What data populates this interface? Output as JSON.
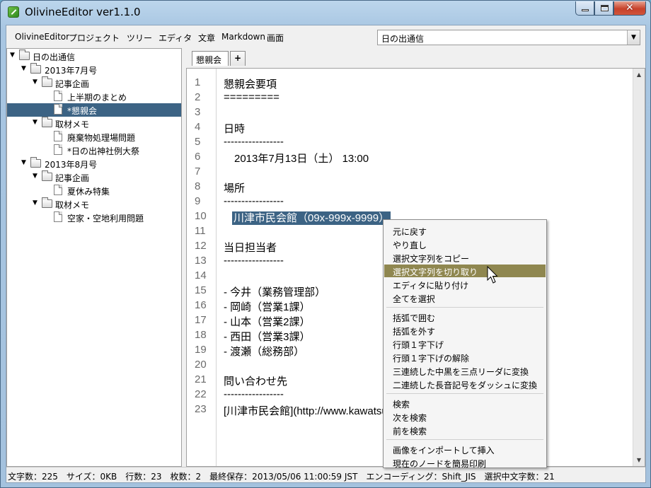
{
  "window": {
    "title": "OlivineEditor ver1.1.0",
    "close_glyph": "✕"
  },
  "menubar": {
    "items": [
      "OlivineEditor",
      "プロジェクト",
      "ツリー",
      "エディタ",
      "文章",
      "Markdown",
      "画面"
    ],
    "document_select": {
      "selected": "日の出通信",
      "arrow": "▼"
    }
  },
  "tree": {
    "items": [
      {
        "label": "日の出通信",
        "type": "folder",
        "expanded": true
      },
      {
        "label": "2013年7月号",
        "type": "folder",
        "expanded": true
      },
      {
        "label": "記事企画",
        "type": "folder",
        "expanded": true
      },
      {
        "label": "上半期のまとめ",
        "type": "page"
      },
      {
        "label": "*懇親会",
        "type": "page",
        "selected": true
      },
      {
        "label": "取材メモ",
        "type": "folder",
        "expanded": true
      },
      {
        "label": "廃棄物処理場問題",
        "type": "page"
      },
      {
        "label": "*日の出神社例大祭",
        "type": "page"
      },
      {
        "label": "2013年8月号",
        "type": "folder",
        "expanded": true
      },
      {
        "label": "記事企画",
        "type": "folder",
        "expanded": true
      },
      {
        "label": "夏休み特集",
        "type": "page"
      },
      {
        "label": "取材メモ",
        "type": "folder",
        "expanded": true
      },
      {
        "label": "空家・空地利用問題",
        "type": "page"
      }
    ],
    "twisty": "▼"
  },
  "tabs": {
    "active_label": "懇親会",
    "add_label": "+"
  },
  "editor": {
    "line_numbers": [
      "1",
      "2",
      "3",
      "4",
      "5",
      "6",
      "7",
      "8",
      "9",
      "10",
      "11",
      "12",
      "13",
      "14",
      "15",
      "16",
      "17",
      "18",
      "19",
      "20",
      "21",
      "22",
      "23"
    ],
    "lines": [
      "懇親会要項",
      "=========",
      "",
      "日時",
      "-----------------",
      "　2013年7月13日（土） 13:00",
      "",
      "場所",
      "-----------------",
      "",
      "",
      "当日担当者",
      "-----------------",
      "",
      "- 今井（業務管理部）",
      "- 岡崎（営業1課）",
      "- 山本（営業2課）",
      "- 西田（営業3課）",
      "- 渡瀬（総務部）",
      "",
      "問い合わせ先",
      "-----------------",
      "[川津市民会館](http://www.kawatsu"
    ],
    "selected_text": "川津市民会館（09x-999x-9999）",
    "scroll_up": "▲",
    "scroll_down": "▼"
  },
  "context_menu": {
    "groups": [
      [
        "元に戻す",
        "やり直し",
        "選択文字列をコピー",
        "選択文字列を切り取り",
        "エディタに貼り付け",
        "全てを選択"
      ],
      [
        "括弧で囲む",
        "括弧を外す",
        "行頭１字下げ",
        "行頭１字下げの解除",
        "三連続した中黒を三点リーダに変換",
        "二連続した長音記号をダッシュに変換"
      ],
      [
        "検索",
        "次を検索",
        "前を検索"
      ],
      [
        "画像をインポートして挿入",
        "現在のノードを簡易印刷"
      ]
    ],
    "hover_item": "選択文字列を切り取り"
  },
  "statusbar": {
    "text": "文字数：225　サイズ：0KB　行数：23　枚数：2　最終保存：2013/05/06 11:00:59 JST　エンコーディング：Shift_JIS　選択中文字数：21"
  },
  "colors": {
    "selection": "#3c6384",
    "menu_hover": "#8f8750"
  }
}
